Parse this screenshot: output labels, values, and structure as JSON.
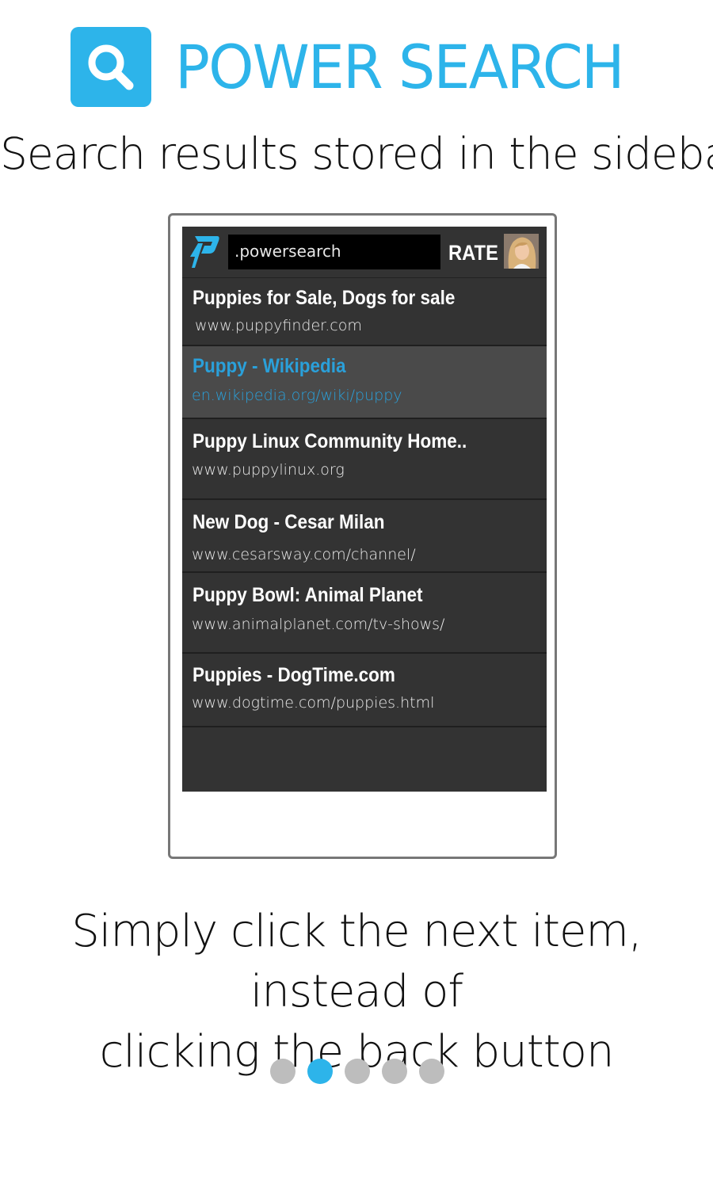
{
  "brand": {
    "title": "POWER SEARCH",
    "accent": "#2db4ea",
    "icon": "search-icon"
  },
  "subtitle": "Search results stored in the sidebar",
  "sidebar": {
    "search_value": ".powersearch",
    "rate_label": "RATE",
    "logo_icon": "power-search-p-logo",
    "results": [
      {
        "title": "Puppies for Sale, Dogs for sale",
        "url": "www.puppyfinder.com",
        "active": false
      },
      {
        "title": "Puppy - Wikipedia",
        "url": "en.wikipedia.org/wiki/puppy",
        "active": true
      },
      {
        "title": "Puppy Linux Community Home..",
        "url": "www.puppylinux.org",
        "active": false
      },
      {
        "title": "New Dog - Cesar Milan",
        "url": "www.cesarsway.com/channel/",
        "active": false
      },
      {
        "title": "Puppy Bowl: Animal Planet",
        "url": "www.animalplanet.com/tv-shows/",
        "active": false
      },
      {
        "title": "Puppies - DogTime.com",
        "url": "www.dogtime.com/puppies.html",
        "active": false
      }
    ]
  },
  "tagline": {
    "line1": "Simply click the next item, instead of",
    "line2": "clicking the back button"
  },
  "pager": {
    "count": 5,
    "active_index": 1
  }
}
